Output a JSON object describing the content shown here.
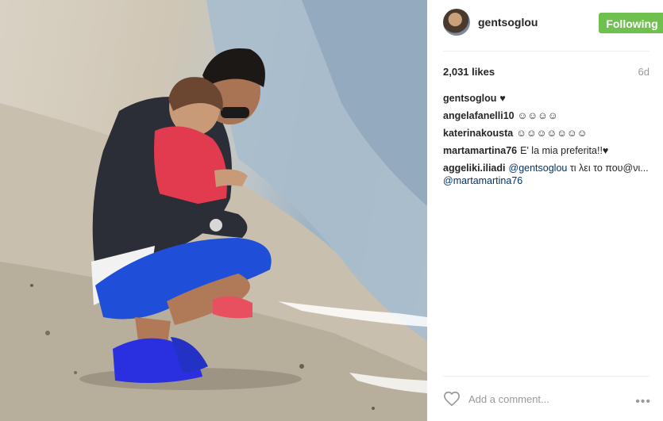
{
  "post": {
    "username": "gentsoglou",
    "follow_label": "Following",
    "likes": "2,031 likes",
    "age": "6d",
    "comments": [
      {
        "user": "gentsoglou",
        "text": "♥"
      },
      {
        "user": "angelafanelli10",
        "text": "☺☺☺☺"
      },
      {
        "user": "katerinakousta",
        "text": "☺☺☺☺☺☺☺"
      },
      {
        "user": "martamartina76",
        "text": "E' la mia preferita!!♥"
      },
      {
        "user": "aggeliki.iliadi",
        "mention1": "@gentsoglou",
        "text1": " τι λει το που@νι... ",
        "mention2": "@martamartina76"
      }
    ],
    "add_comment_placeholder": "Add a comment...",
    "more_label": "•••"
  },
  "colors": {
    "follow_button": "#70c050",
    "mention": "#003569"
  },
  "icons": {
    "like": "heart-outline-icon",
    "more": "more-options-icon"
  }
}
